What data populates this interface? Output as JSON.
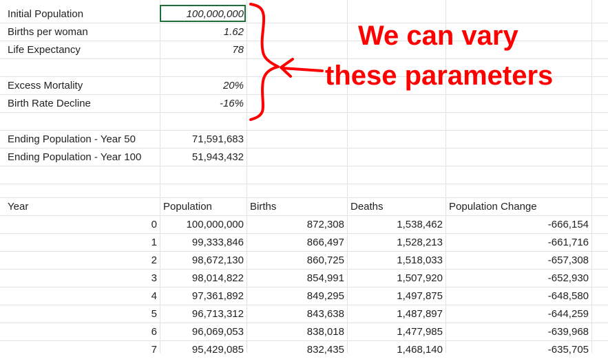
{
  "params": [
    {
      "label": "Initial Population",
      "value": "100,000,000"
    },
    {
      "label": "Births per woman",
      "value": "1.62"
    },
    {
      "label": "Life Expectancy",
      "value": "78"
    },
    {
      "label": "Excess Mortality",
      "value": "20%"
    },
    {
      "label": "Birth Rate Decline",
      "value": "-16%"
    }
  ],
  "results": [
    {
      "label": "Ending Population - Year 50",
      "value": "71,591,683"
    },
    {
      "label": "Ending Population - Year 100",
      "value": "51,943,432"
    }
  ],
  "table": {
    "headers": [
      "Year",
      "Population",
      "Births",
      "Deaths",
      "Population Change"
    ],
    "rows": [
      [
        "0",
        "100,000,000",
        "872,308",
        "1,538,462",
        "-666,154"
      ],
      [
        "1",
        "99,333,846",
        "866,497",
        "1,528,213",
        "-661,716"
      ],
      [
        "2",
        "98,672,130",
        "860,725",
        "1,518,033",
        "-657,308"
      ],
      [
        "3",
        "98,014,822",
        "854,991",
        "1,507,920",
        "-652,930"
      ],
      [
        "4",
        "97,361,892",
        "849,295",
        "1,497,875",
        "-648,580"
      ],
      [
        "5",
        "96,713,312",
        "843,638",
        "1,487,897",
        "-644,259"
      ],
      [
        "6",
        "96,069,053",
        "838,018",
        "1,477,985",
        "-639,968"
      ],
      [
        "7",
        "95,429,085",
        "832,435",
        "1,468,140",
        "-635,705"
      ]
    ]
  },
  "annotation": {
    "line1": "We can vary",
    "line2": "these parameters",
    "color": "#ff0000"
  },
  "colors": {
    "selection_border": "#1f6e3a",
    "gridline": "#e2e2e2"
  }
}
